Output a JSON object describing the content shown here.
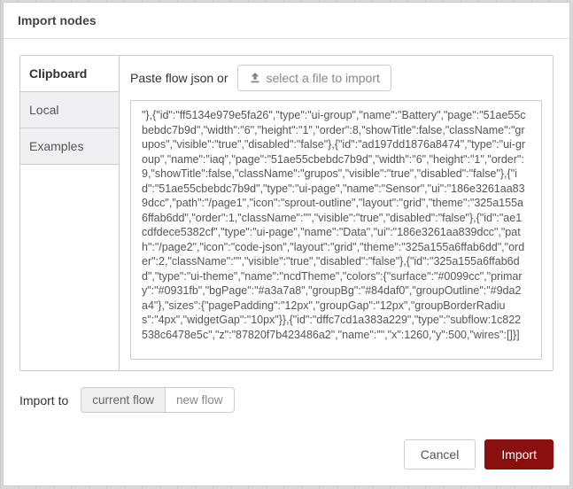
{
  "dialog": {
    "title": "Import nodes"
  },
  "tabs": {
    "clipboard": "Clipboard",
    "local": "Local",
    "examples": "Examples"
  },
  "paste": {
    "prompt": "Paste flow json or",
    "select_file_label": "select a file to import",
    "json_content": "\"},{\"id\":\"ff5134e979e5fa26\",\"type\":\"ui-group\",\"name\":\"Battery\",\"page\":\"51ae55cbebdc7b9d\",\"width\":\"6\",\"height\":\"1\",\"order\":8,\"showTitle\":false,\"className\":\"grupos\",\"visible\":\"true\",\"disabled\":\"false\"},{\"id\":\"ad197dd1876a8474\",\"type\":\"ui-group\",\"name\":\"iaq\",\"page\":\"51ae55cbebdc7b9d\",\"width\":\"6\",\"height\":\"1\",\"order\":9,\"showTitle\":false,\"className\":\"grupos\",\"visible\":\"true\",\"disabled\":\"false\"},{\"id\":\"51ae55cbebdc7b9d\",\"type\":\"ui-page\",\"name\":\"Sensor\",\"ui\":\"186e3261aa839dcc\",\"path\":\"/page1\",\"icon\":\"sprout-outline\",\"layout\":\"grid\",\"theme\":\"325a155a6ffab6dd\",\"order\":1,\"className\":\"\",\"visible\":\"true\",\"disabled\":\"false\"},{\"id\":\"ae1cdfdece5382cf\",\"type\":\"ui-page\",\"name\":\"Data\",\"ui\":\"186e3261aa839dcc\",\"path\":\"/page2\",\"icon\":\"code-json\",\"layout\":\"grid\",\"theme\":\"325a155a6ffab6dd\",\"order\":2,\"className\":\"\",\"visible\":\"true\",\"disabled\":\"false\"},{\"id\":\"325a155a6ffab6dd\",\"type\":\"ui-theme\",\"name\":\"ncdTheme\",\"colors\":{\"surface\":\"#0099cc\",\"primary\":\"#0931fb\",\"bgPage\":\"#a3a7a8\",\"groupBg\":\"#84daf0\",\"groupOutline\":\"#9da2a4\"},\"sizes\":{\"pagePadding\":\"12px\",\"groupGap\":\"12px\",\"groupBorderRadius\":\"4px\",\"widgetGap\":\"10px\"}},{\"id\":\"dffc7cd1a383a229\",\"type\":\"subflow:1c822538c6478e5c\",\"z\":\"87820f7b423486a2\",\"name\":\"\",\"x\":1260,\"y\":500,\"wires\":[]}]"
  },
  "import_to": {
    "label": "Import to",
    "current_flow": "current flow",
    "new_flow": "new flow"
  },
  "footer": {
    "cancel": "Cancel",
    "import": "Import"
  },
  "icons": {
    "upload": "upload-icon"
  },
  "colors": {
    "primary_action": "#8a0f0f"
  }
}
